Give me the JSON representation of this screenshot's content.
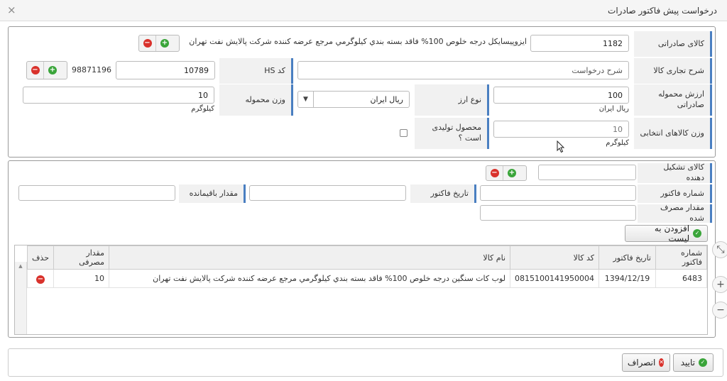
{
  "dialog": {
    "title": "درخواست پیش فاکتور صادرات",
    "close": "×"
  },
  "form": {
    "export_goods": {
      "label": "کالای صادراتی",
      "code": "1182",
      "name": "ايزوپيسايكل درجه خلوص 100% فاقد بسته بندي كيلوگرمي مرجع عرضه كننده شركت پالايش نفت تهران"
    },
    "trade_desc": {
      "label": "شرح تجاری کالا",
      "placeholder": "شرح درخواست"
    },
    "hs_code": {
      "label": "کد HS",
      "value": "10789",
      "code": "98871196"
    },
    "shipment_value": {
      "label": "ارزش محموله صادراتی",
      "value": "100",
      "unit": "ریال ایران"
    },
    "currency": {
      "label": "نوع ارز",
      "selected": "ریال ایران",
      "arrow": "▼"
    },
    "shipment_weight": {
      "label": "وزن محموله",
      "value": "10",
      "unit": "کیلوگرم"
    },
    "selected_weight": {
      "label": "وزن کالاهای انتخابی",
      "value": "10",
      "unit": "کیلوگرم"
    },
    "is_product": {
      "label": "محصول تولیدی است ؟"
    }
  },
  "components": {
    "component_goods": {
      "label": "کالای تشکیل دهنده"
    },
    "invoice_no": {
      "label": "شماره فاکتور"
    },
    "invoice_date": {
      "label": "تاریخ فاکتور"
    },
    "remaining": {
      "label": "مقدار باقیمانده"
    },
    "consumed": {
      "label": "مقدار مصرف شده"
    },
    "add_button": "افزودن به لیست"
  },
  "table": {
    "headers": [
      "شماره فاکتور",
      "تاریخ فاکتور",
      "کد کالا",
      "نام کالا",
      "مقدار مصرفی",
      "حذف"
    ],
    "rows": [
      {
        "invoice_no": "6483",
        "invoice_date": "1394/12/19",
        "goods_code": "0815100141950004",
        "goods_name": "لوب كات سنگين درجه خلوص 100% فاقد بسته بندي كيلوگرمي مرجع عرضه كننده شركت پالايش نفت تهران",
        "quantity": "10"
      }
    ]
  },
  "side_controls": {
    "shrink": "⤡",
    "plus": "+",
    "minus": "−"
  },
  "footer": {
    "confirm": "تایید",
    "cancel": "انصراف"
  },
  "colors": {
    "label_accent": "#4a7fc1",
    "remove_red": "#d9322c",
    "add_green": "#3aa53a"
  }
}
